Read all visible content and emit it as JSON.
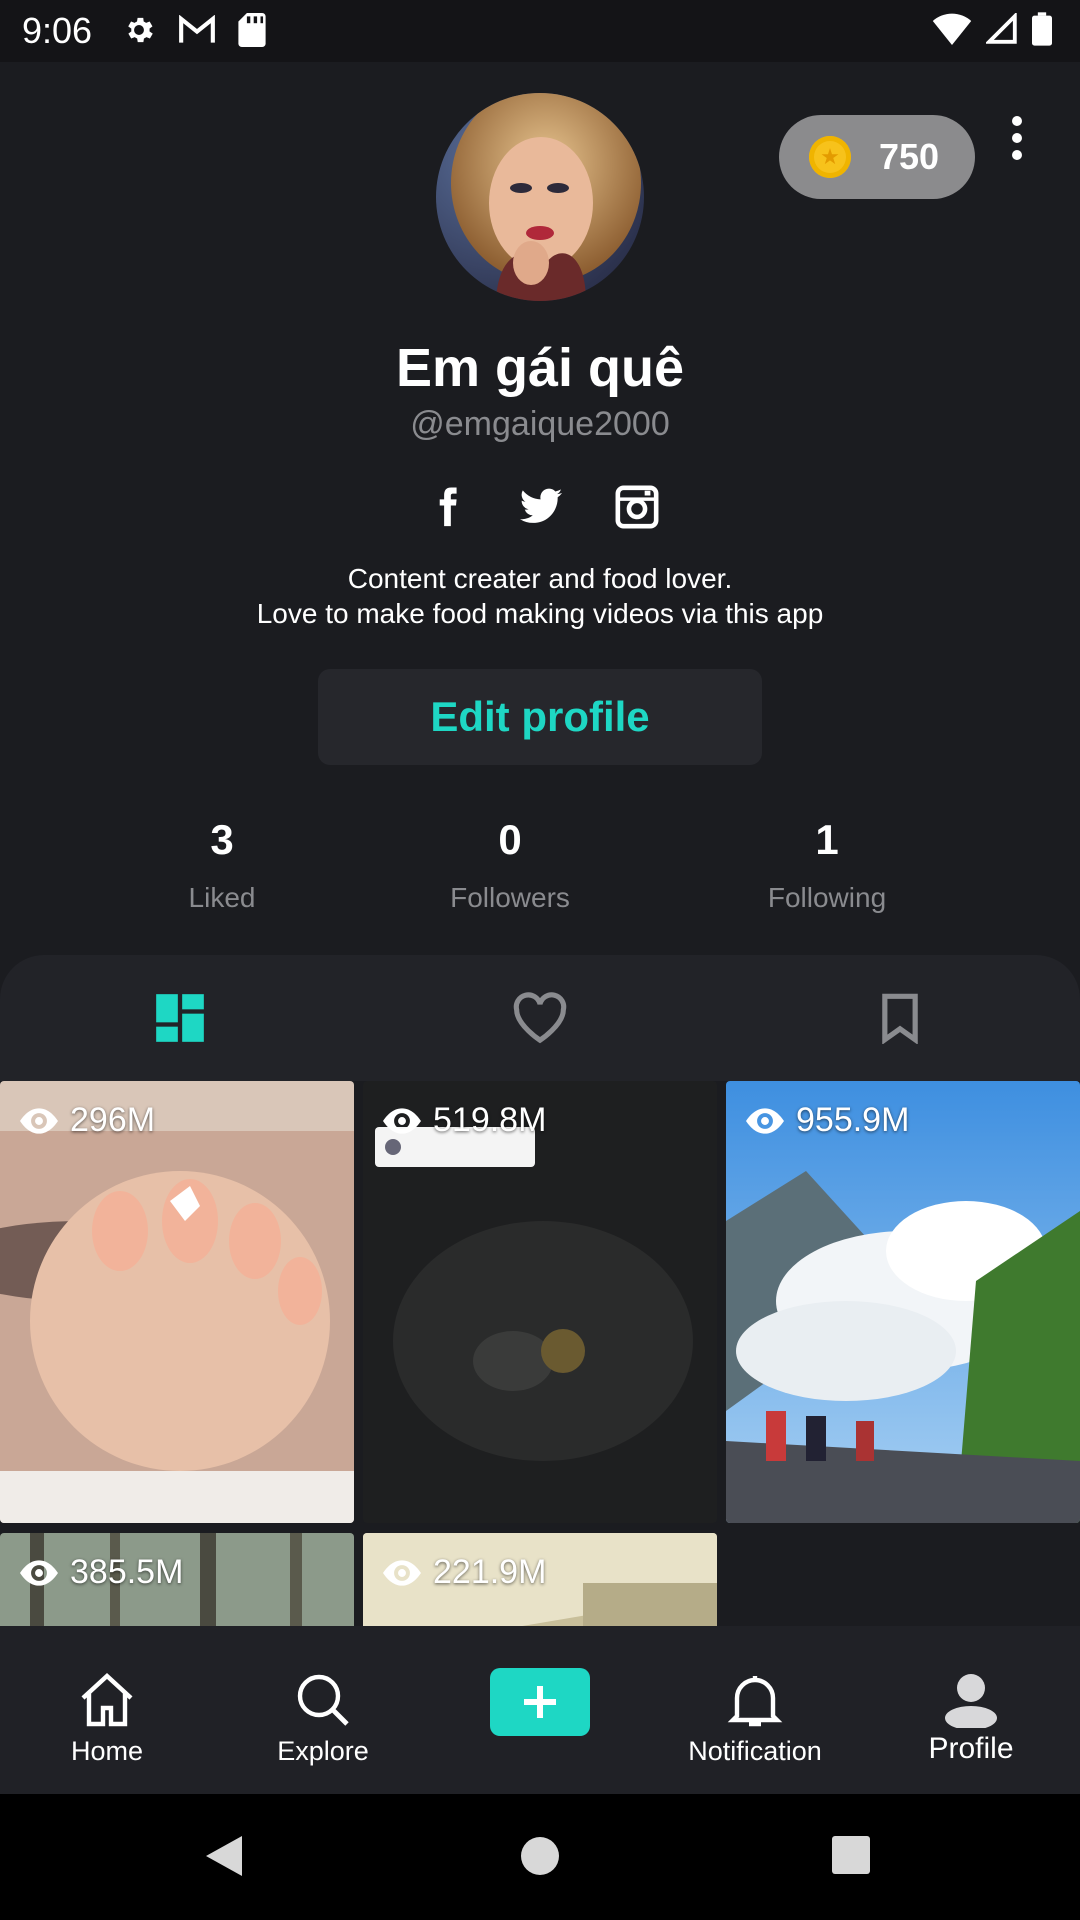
{
  "status": {
    "time": "9:06"
  },
  "coins": {
    "value": "750"
  },
  "profile": {
    "name": "Em gái quê",
    "handle": "@emgaique2000",
    "bio_line1": "Content creater and food lover.",
    "bio_line2": "Love to make food making videos via this app",
    "edit_label": "Edit profile"
  },
  "stats": [
    {
      "value": "3",
      "label": "Liked"
    },
    {
      "value": "0",
      "label": "Followers"
    },
    {
      "value": "1",
      "label": "Following"
    }
  ],
  "videos": [
    {
      "views": "296M"
    },
    {
      "views": "519.8M"
    },
    {
      "views": "955.9M"
    },
    {
      "views": "385.5M"
    },
    {
      "views": "221.9M"
    }
  ],
  "nav": {
    "home": "Home",
    "explore": "Explore",
    "notification": "Notification",
    "profile": "Profile"
  },
  "colors": {
    "accent": "#1ed7c4",
    "background": "#1b1c20",
    "coin": "#f7c21b"
  }
}
